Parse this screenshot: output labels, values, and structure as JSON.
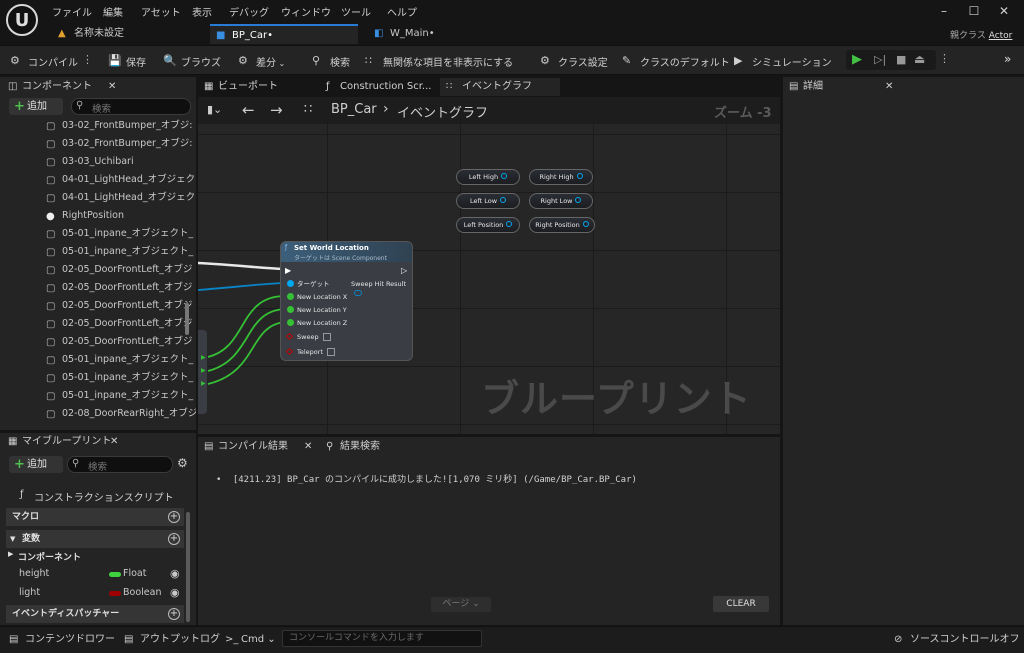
{
  "menu": [
    "ファイル",
    "編集",
    "アセット",
    "表示",
    "デバッグ",
    "ウィンドウ",
    "ツール",
    "ヘルプ"
  ],
  "tabs": {
    "unsaved": "名称未設定",
    "bp_car": "BP_Car•",
    "w_main": "W_Main•",
    "parent_label": "親クラス",
    "parent_value": "Actor"
  },
  "toolbar": {
    "compile": "コンパイル",
    "save": "保存",
    "browse": "ブラウズ",
    "diff": "差分",
    "find": "検索",
    "hide_unrelated": "無関係な項目を非表示にする",
    "class_settings": "クラス設定",
    "class_defaults": "クラスのデフォルト",
    "simulation": "シミュレーション"
  },
  "components_panel": {
    "title": "コンポーネント",
    "add": "追加",
    "search_placeholder": "検索",
    "items": [
      "03-02_FrontBumper_オブジ:",
      "03-02_FrontBumper_オブジ:",
      "03-03_Uchibari",
      "04-01_LightHead_オブジェク",
      "04-01_LightHead_オブジェク",
      "RightPosition",
      "05-01_inpane_オブジェクト_",
      "05-01_inpane_オブジェクト_",
      "02-05_DoorFrontLeft_オブジ",
      "02-05_DoorFrontLeft_オブジ",
      "02-05_DoorFrontLeft_オブジ",
      "02-05_DoorFrontLeft_オブジ",
      "02-05_DoorFrontLeft_オブジ",
      "05-01_inpane_オブジェクト_",
      "05-01_inpane_オブジェクト_",
      "05-01_inpane_オブジェクト_",
      "02-08_DoorRearRight_オブジ"
    ]
  },
  "my_blueprint": {
    "title": "マイブループリント",
    "add": "追加",
    "search_placeholder": "検索",
    "construction_script": "コンストラクションスクリプト",
    "macros": "マクロ",
    "variables": "変数",
    "components": "コンポーネント",
    "vars": [
      {
        "name": "height",
        "type": "Float",
        "color": "#3fd43f"
      },
      {
        "name": "light",
        "type": "Boolean",
        "color": "#a00000"
      }
    ],
    "event_dispatchers": "イベントディスパッチャー"
  },
  "graph_tabs": {
    "viewport": "ビューポート",
    "construction": "Construction Scr...",
    "event_graph": "イベントグラフ"
  },
  "breadcrumb": {
    "bp": "BP_Car",
    "graph": "イベントグラフ",
    "zoom": "ズーム -3"
  },
  "watermark": "ブループリント",
  "node": {
    "title": "Set World Location",
    "subtitle": "ターゲットは Scene Component",
    "target": "ターゲット",
    "sweep_hit": "Sweep Hit Result",
    "loc_x": "New Location X",
    "loc_y": "New Location Y",
    "loc_z": "New Location Z",
    "sweep": "Sweep",
    "teleport": "Teleport"
  },
  "var_nodes": [
    "Left High",
    "Right High",
    "Left Low",
    "Right Low",
    "Left Position",
    "Right Position"
  ],
  "details": {
    "title": "詳細"
  },
  "compiler": {
    "tab1": "コンパイル結果",
    "tab2": "結果検索",
    "message": "[4211.23] BP_Car のコンパイルに成功しました![1,070 ミリ秒] (/Game/BP_Car.BP_Car)",
    "page": "ページ",
    "clear": "CLEAR"
  },
  "statusbar": {
    "content_drawer": "コンテンツドロワー",
    "output_log": "アウトプットログ",
    "cmd": "Cmd",
    "console_placeholder": "コンソールコマンドを入力します",
    "source_control": "ソースコントロールオフ"
  },
  "colors": {
    "exec": "#ffffff",
    "object_pin": "#00a8f0",
    "float_pin": "#3fd43f",
    "bool_pin": "#a00000",
    "play": "#43c043",
    "node_header": "#3d5f7a"
  }
}
